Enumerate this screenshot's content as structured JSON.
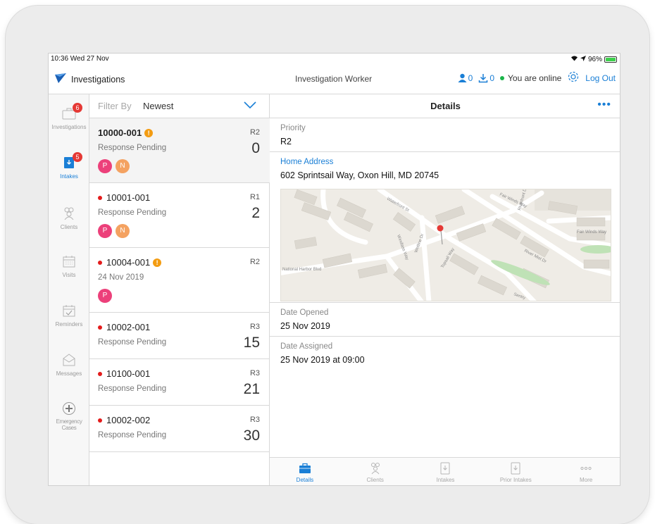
{
  "status_bar": {
    "time": "10:36  Wed 27 Nov",
    "battery": "96%",
    "battery_level": 0.96
  },
  "nav": {
    "app_title": "Investigations",
    "role": "Investigation Worker",
    "user_count": "0",
    "download_count": "0",
    "online_status": "You are online",
    "logout": "Log Out"
  },
  "sidebar": {
    "items": [
      {
        "label": "Investigations",
        "badge": "6",
        "icon": "briefcase-icon"
      },
      {
        "label": "Intakes",
        "badge": "5",
        "icon": "intake-icon"
      },
      {
        "label": "Clients",
        "badge": "",
        "icon": "people-icon"
      },
      {
        "label": "Visits",
        "badge": "",
        "icon": "calendar-icon"
      },
      {
        "label": "Reminders",
        "badge": "",
        "icon": "calendar-check-icon"
      },
      {
        "label": "Messages",
        "badge": "",
        "icon": "envelope-icon"
      },
      {
        "label": "Emergency Cases",
        "badge": "",
        "icon": "plus-circle-icon"
      }
    ]
  },
  "list": {
    "filter_label": "Filter By",
    "filter_value": "Newest",
    "rows": [
      {
        "id": "10000-001",
        "status": "Response Pending",
        "code": "R2",
        "count": "0",
        "chips": [
          "P",
          "N"
        ]
      },
      {
        "id": "10001-001",
        "status": "Response Pending",
        "code": "R1",
        "count": "2",
        "chips": [
          "P",
          "N"
        ]
      },
      {
        "id": "10004-001",
        "status": "24 Nov 2019",
        "code": "R2",
        "count": "",
        "chips": [
          "P"
        ]
      },
      {
        "id": "10002-001",
        "status": "Response Pending",
        "code": "R3",
        "count": "15",
        "chips": []
      },
      {
        "id": "10100-001",
        "status": "Response Pending",
        "code": "R3",
        "count": "21",
        "chips": []
      },
      {
        "id": "10002-002",
        "status": "Response Pending",
        "code": "R3",
        "count": "30",
        "chips": []
      }
    ]
  },
  "detail": {
    "title": "Details",
    "more": "•••",
    "priority_label": "Priority",
    "priority_value": "R2",
    "address_label": "Home Address",
    "address_value": "602 Sprintsail Way, Oxon Hill, MD 20745",
    "map_labels": {
      "waterfront": "Waterfront St",
      "fair_winds_way_top": "Fair Winds Way",
      "fair_winds_way_right": "Fair Winds Way",
      "riverfront": "Riverfront Dr",
      "river_mist": "River Mist Dr",
      "windlass": "Windlass Way",
      "wetline": "Wetline Dr",
      "topsail": "Topsail Way",
      "national_harbor": "National Harbor Blvd",
      "sentry": "Sentry"
    },
    "date_opened_label": "Date Opened",
    "date_opened_value": "25 Nov 2019",
    "date_assigned_label": "Date Assigned",
    "date_assigned_value": "25 Nov 2019 at 09:00"
  },
  "tabs": [
    {
      "label": "Details",
      "active": true
    },
    {
      "label": "Clients",
      "active": false
    },
    {
      "label": "Intakes",
      "active": false
    },
    {
      "label": "Prior Intakes",
      "active": false
    },
    {
      "label": "More",
      "active": false
    }
  ],
  "colors": {
    "accent": "#1a7fd6",
    "badge": "#e53935",
    "online": "#1ab54a",
    "warning": "#f39c12",
    "chip_p": "#ec407a",
    "chip_n": "#f4a261"
  }
}
